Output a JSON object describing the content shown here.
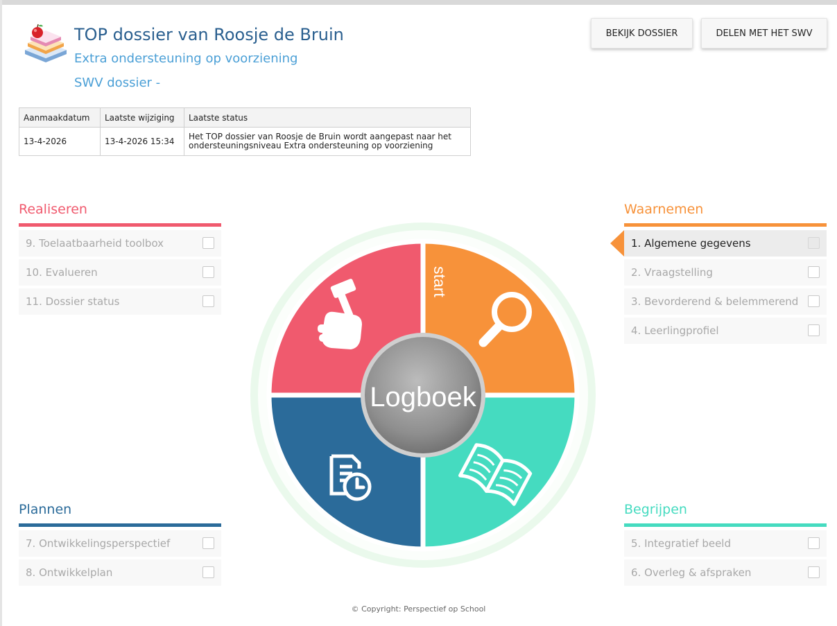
{
  "header": {
    "title": "TOP dossier van Roosje de Bruin",
    "subtitle": "Extra ondersteuning op voorziening",
    "swv_label": "SWV dossier -",
    "logo_icon": "books-apple-icon"
  },
  "actions": {
    "view_label": "BEKIJK DOSSIER",
    "share_label": "DELEN MET HET SWV"
  },
  "info_table": {
    "headers": [
      "Aanmaakdatum",
      "Laatste wijziging",
      "Laatste status"
    ],
    "row": [
      "13-4-2026",
      "13-4-2026 15:34",
      "Het TOP dossier van Roosje de Bruin wordt aangepast naar het ondersteuningsniveau Extra ondersteuning op voorziening"
    ]
  },
  "phases": {
    "realiseren": {
      "title": "Realiseren",
      "color": "#f05a6e",
      "steps": [
        {
          "label": "9. Toelaatbaarheid toolbox",
          "checked": false
        },
        {
          "label": "10. Evalueren",
          "checked": false
        },
        {
          "label": "11. Dossier status",
          "checked": false
        }
      ]
    },
    "waarnemen": {
      "title": "Waarnemen",
      "color": "#f7923a",
      "steps": [
        {
          "label": "1. Algemene gegevens",
          "checked": false,
          "active": true
        },
        {
          "label": "2. Vraagstelling",
          "checked": false
        },
        {
          "label": "3. Bevorderend & belemmerend",
          "checked": false
        },
        {
          "label": "4. Leerlingprofiel",
          "checked": false
        }
      ]
    },
    "plannen": {
      "title": "Plannen",
      "color": "#2b6b9a",
      "steps": [
        {
          "label": "7. Ontwikkelingsperspectief",
          "checked": false
        },
        {
          "label": "8. Ontwikkelplan",
          "checked": false
        }
      ]
    },
    "begrijpen": {
      "title": "Begrijpen",
      "color": "#45dbc0",
      "steps": [
        {
          "label": "5. Integratief beeld",
          "checked": false
        },
        {
          "label": "6. Overleg & afspraken",
          "checked": false
        }
      ]
    }
  },
  "wheel": {
    "center_label": "Logboek",
    "start_label": "start",
    "ring_color": "#eaf9ec",
    "quadrants": [
      {
        "name": "realiseren",
        "color": "#f05a6e",
        "icon": "hand-hammer-icon"
      },
      {
        "name": "waarnemen",
        "color": "#f7923a",
        "icon": "magnifier-icon"
      },
      {
        "name": "plannen",
        "color": "#2b6b9a",
        "icon": "document-clock-icon"
      },
      {
        "name": "begrijpen",
        "color": "#45dbc0",
        "icon": "open-book-icon"
      }
    ]
  },
  "footer": {
    "copyright": "© Copyright: Perspectief op School"
  }
}
